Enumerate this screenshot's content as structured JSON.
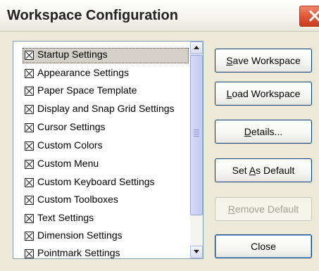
{
  "window": {
    "title": "Workspace Configuration",
    "close_icon": "close-icon"
  },
  "list": {
    "items": [
      {
        "label": "Startup Settings",
        "checked": true,
        "selected": true
      },
      {
        "label": "Appearance Settings",
        "checked": true
      },
      {
        "label": "Paper Space Template",
        "checked": true
      },
      {
        "label": "Display and Snap Grid Settings",
        "checked": true
      },
      {
        "label": "Cursor Settings",
        "checked": true
      },
      {
        "label": "Custom Colors",
        "checked": true
      },
      {
        "label": "Custom Menu",
        "checked": true
      },
      {
        "label": "Custom Keyboard Settings",
        "checked": true
      },
      {
        "label": "Custom Toolboxes",
        "checked": true
      },
      {
        "label": "Text Settings",
        "checked": true
      },
      {
        "label": "Dimension Settings",
        "checked": true
      },
      {
        "label": "Pointmark Settings",
        "checked": true
      }
    ]
  },
  "buttons": {
    "save_workspace": {
      "before": "",
      "accel": "S",
      "after": "ave Workspace"
    },
    "load_workspace": {
      "before": "",
      "accel": "L",
      "after": "oad Workspace"
    },
    "details": {
      "before": "",
      "accel": "D",
      "after": "etails..."
    },
    "set_as_default": {
      "before": "Set ",
      "accel": "A",
      "after": "s Default"
    },
    "remove_default": {
      "before": "",
      "accel": "R",
      "after": "emove Default",
      "enabled": false
    },
    "close": {
      "label": "Close"
    }
  }
}
